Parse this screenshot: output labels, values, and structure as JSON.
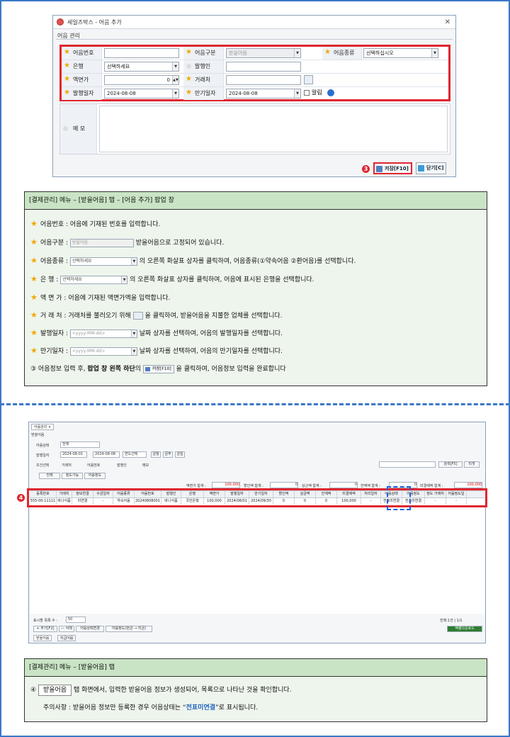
{
  "dialog": {
    "title": "세일즈박스 - 어음 추가",
    "close": "✕",
    "section": "어음 관리",
    "rows": [
      {
        "l1": "어음번호",
        "v1": "",
        "l2": "어음구분",
        "v2": "받을어음",
        "l3": "어음종류",
        "v3": "선택하십시오"
      },
      {
        "l1": "은행",
        "v1": "선택하세요",
        "l2": "발행인",
        "v2": ""
      },
      {
        "l1": "액면가",
        "v1": "0",
        "l2": "거래처",
        "v2": ""
      },
      {
        "l1": "발행일자",
        "v1": "2024-08-08",
        "l2": "만기일자",
        "v2": "2024-08-08",
        "chk": "알림"
      }
    ],
    "memo_label": "메 모",
    "marker3": "3",
    "save": "저장[F10]",
    "closebtn": "닫기[C]"
  },
  "panel1": {
    "header": "[결제관리] 메뉴 – [받을어음] 탭 – [어음 추가] 팝업 창",
    "l1": "어음번호 : 어음에 기재된 번호를 입력합니다.",
    "l2a": "어음구분 :",
    "l2s": "받을어음",
    "l2b": "받을어음으로 고정되어 있습니다.",
    "l3a": "어음종류 :",
    "l3s": "선택하세요",
    "l3b": "의 오른쪽 화살표 상자를 클릭하여, 어음종류(①약속어음 ②환어음)를 선택합니다.",
    "l4a": "은       행 :",
    "l4s": "선택하세요",
    "l4b": "의 오른쪽 화살표 상자를 클릭하여, 어음에 표시된 은행을 선택합니다.",
    "l5": "액   면  가 : 어음에 기재된 액면가액을 입력합니다.",
    "l6a": "거   래  처 : 거래처를 불러오기 위해",
    "l6b": "을 클릭하여, 받을어음을 지불한 업체를 선택합니다.",
    "l7a": "발행일자 :",
    "l7s": "<yyyy-MM-dd>",
    "l7b": "날짜 상자를 선택하여, 어음의 발행일자를 선택합니다.",
    "l8a": "만기일자 :",
    "l8s": "<yyyy-MM-dd>",
    "l8b": "날짜 상자를 선택하여, 어음의 만기일자를 선택합니다.",
    "l9a": "③  어음정보 입력 후,",
    "l9bold": "팝업 창 왼쪽 하단",
    "l9c": "의",
    "l9btn": "저장[F10]",
    "l9d": "을 클릭하여, 어음정보 입력을 완료합니다"
  },
  "screen": {
    "tab": "어음관리 ×",
    "sub": "받을어음",
    "f1": "어음상태",
    "f1v": "전체",
    "f2": "발행일자",
    "d1": "2024-08-01",
    "d2": "2024-08-08",
    "range": "연도선택",
    "b1": "금월",
    "b2": "금주",
    "b3": "금일",
    "f3": "조건선택",
    "r1": "거래처",
    "r2": "어음번호",
    "r3": "발행인",
    "r4": "메모",
    "search": "검색[F5]",
    "reset": "리셋",
    "tabs": [
      "전체",
      "정도가능",
      "어음정도"
    ],
    "sums": [
      {
        "l": "액면가 합계 :",
        "v": "100,000"
      },
      {
        "l": "할인액 합계 :",
        "v": "0"
      },
      {
        "l": "상근액 합계 :",
        "v": "0"
      },
      {
        "l": "잔액액 합계 :",
        "v": "0"
      },
      {
        "l": "미결제액 합계 :",
        "v": "100,000"
      }
    ],
    "cols": [
      "등록번호",
      "거래처",
      "정보연결",
      "수금일자",
      "어음종류",
      "어음번호",
      "발행인",
      "은행",
      "액면가",
      "발행일자",
      "만기일자",
      "할인액",
      "실금액",
      "잔계액",
      "미결제액",
      "처리일자",
      "어음상태",
      "어음정도",
      "정도 거래처",
      "어음정도일"
    ],
    "row": [
      "555-00-11111",
      "바나식품",
      "미연결",
      "-",
      "약속어음",
      "20240808001",
      "바나식품",
      "국민은행",
      "100,000",
      "2024/08/01",
      "2024/09/30",
      "0",
      "0",
      "0",
      "100,000",
      "-",
      "전표미연결",
      "전표미연결",
      "-",
      "-"
    ],
    "marker4": "4",
    "perpage": "표시할 목록 수 :",
    "perpage_v": "50",
    "pageinfo": "전체:1건 | 1/1",
    "bottom": [
      "+ 추가[F2]",
      "— 삭제",
      "어음상태변경",
      "어음정도(현금 → 지금)"
    ],
    "excel": "엑셀다운로드",
    "btabs": [
      "받을어음",
      "지급어음"
    ]
  },
  "panel2": {
    "header": "[결제관리] 메뉴 – [받을어음] 탭",
    "l1a": "④",
    "l1tab": "받을어음",
    "l1b": "탭 화면에서, 입력한 받을어음 정보가 생성되어, 목록으로 나타난 것을 확인합니다.",
    "l2a": "주의사항 :  받을어음 정보만 등록한 경우 어음상태는 “",
    "l2b": "전표미연결",
    "l2c": "”로 표시됩니다."
  }
}
